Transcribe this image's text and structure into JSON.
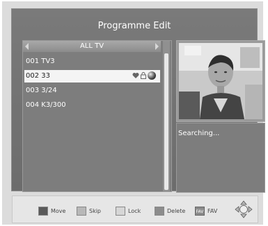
{
  "header": {
    "title": "Programme Edit"
  },
  "list": {
    "group_label": "ALL TV",
    "items": [
      {
        "number": "001",
        "name": "TV3",
        "label": "001 TV3"
      },
      {
        "number": "002",
        "name": "33",
        "label": "002 33",
        "selected": true
      },
      {
        "number": "003",
        "name": "3/24",
        "label": "003 3/24"
      },
      {
        "number": "004",
        "name": "K3/300",
        "label": "004 K3/300"
      }
    ]
  },
  "preview": {
    "status": "Searching..."
  },
  "legend": {
    "items": [
      {
        "label": "Move",
        "color": "#5a5a5a"
      },
      {
        "label": "Skip",
        "color": "#b8b8b8"
      },
      {
        "label": "Lock",
        "color": "#d6d6d6"
      },
      {
        "label": "Delete",
        "color": "#8c8c8c"
      },
      {
        "key": "FAV",
        "label": "FAV"
      }
    ]
  },
  "icons": [
    "left-arrow-icon",
    "right-arrow-icon",
    "heart-icon",
    "lock-icon",
    "globe-icon",
    "dpad-icon"
  ]
}
